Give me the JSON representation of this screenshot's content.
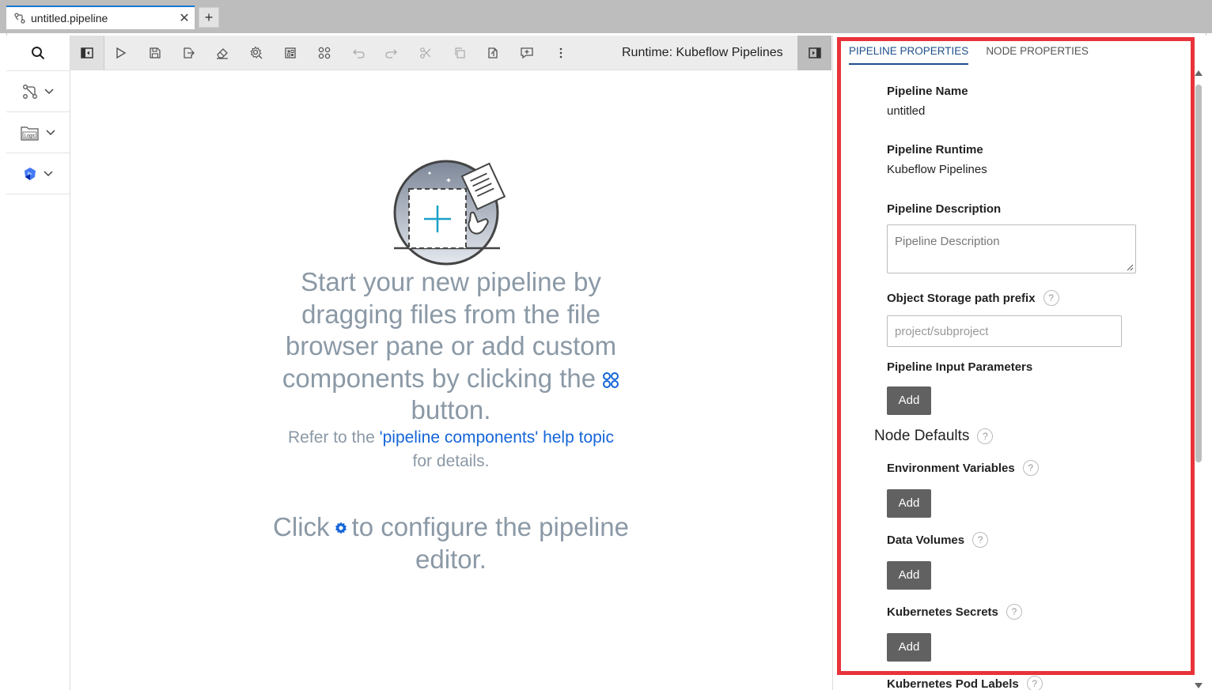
{
  "doc_tab": {
    "title": "untitled.pipeline",
    "close": "✕",
    "new_tab": "+"
  },
  "toolbar": {
    "runtime_label": "Runtime: Kubeflow Pipelines"
  },
  "canvas": {
    "empty_main": "Start your new pipeline by dragging files from the file browser pane or add custom components by clicking the",
    "empty_main_after": "button.",
    "help_prefix": "Refer to the",
    "help_link": "'pipeline components' help topic",
    "help_suffix": "for details.",
    "config_prefix": "Click",
    "config_suffix": "to configure the pipeline editor."
  },
  "panel": {
    "tabs": [
      "PIPELINE PROPERTIES",
      "NODE PROPERTIES"
    ],
    "pipeline_name_label": "Pipeline Name",
    "pipeline_name_value": "untitled",
    "pipeline_runtime_label": "Pipeline Runtime",
    "pipeline_runtime_value": "Kubeflow Pipelines",
    "pipeline_description_label": "Pipeline Description",
    "pipeline_description_placeholder": "Pipeline Description",
    "storage_prefix_label": "Object Storage path prefix",
    "storage_prefix_placeholder": "project/subproject",
    "input_params_label": "Pipeline Input Parameters",
    "add_label": "Add",
    "node_defaults_title": "Node Defaults",
    "env_vars_label": "Environment Variables",
    "data_volumes_label": "Data Volumes",
    "k8s_secrets_label": "Kubernetes Secrets",
    "k8s_pod_labels_label": "Kubernetes Pod Labels",
    "help_glyph": "?"
  },
  "colors": {
    "accent_blue": "#1565d8",
    "empty_text": "#8b99a6",
    "add_button": "#616161",
    "highlight": "#e8333a"
  }
}
